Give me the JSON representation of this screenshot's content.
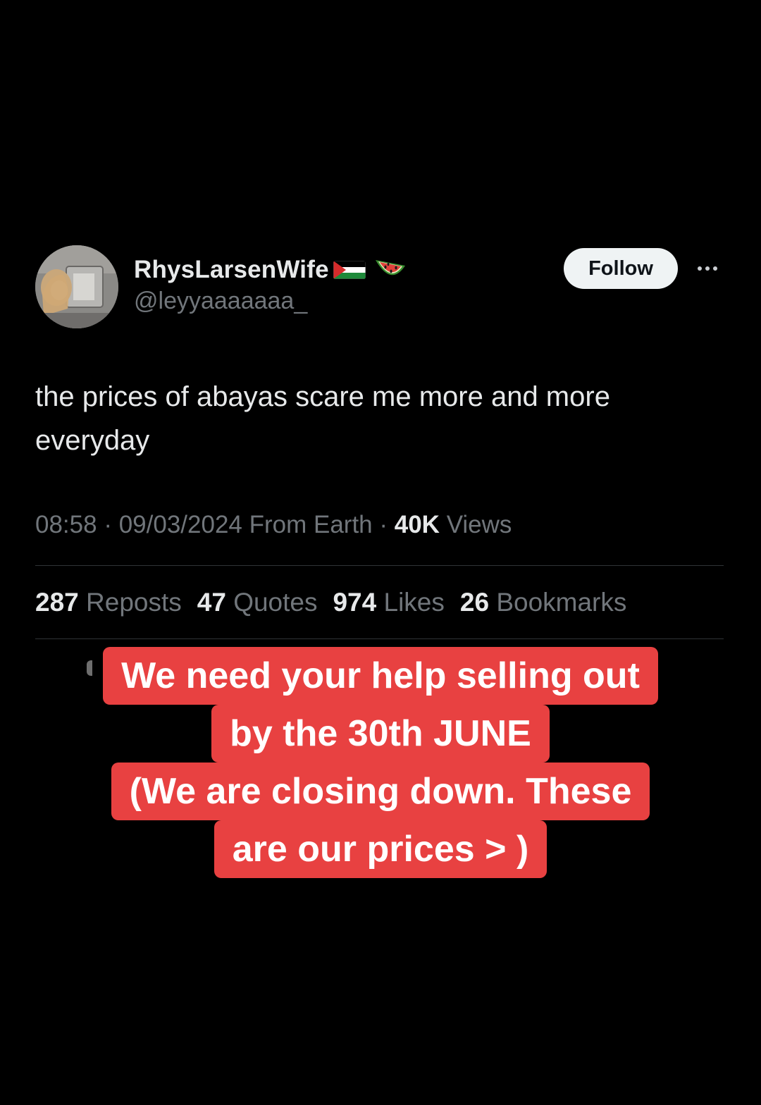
{
  "tweet": {
    "display_name": "RhysLarsenWife",
    "handle": "@leyyaaaaaaa_",
    "follow_label": "Follow",
    "text": "the prices of abayas scare me more and more everyday",
    "meta": {
      "time": "08:58",
      "sep1": " · ",
      "date": "09/03/2024",
      "from": " From Earth",
      "sep2": " · ",
      "views_count": "40K",
      "views_label": " Views"
    },
    "stats": [
      {
        "count": "287",
        "label": "Reposts"
      },
      {
        "count": "47",
        "label": "Quotes"
      },
      {
        "count": "974",
        "label": "Likes"
      },
      {
        "count": "26",
        "label": "Bookmarks"
      }
    ]
  },
  "overlay": {
    "lines": [
      "We need your help selling out",
      "by the 30th JUNE",
      "(We are closing down. These",
      "are our prices > )"
    ],
    "background_color": "#e84141"
  },
  "colors": {
    "background": "#000000",
    "text_primary": "#e7e9ea",
    "text_secondary": "#71767b",
    "follow_button_bg": "#eff3f4"
  },
  "icons": [
    "avatar-photo",
    "palestine-flag-icon",
    "watermelon-icon",
    "more-options-icon"
  ]
}
